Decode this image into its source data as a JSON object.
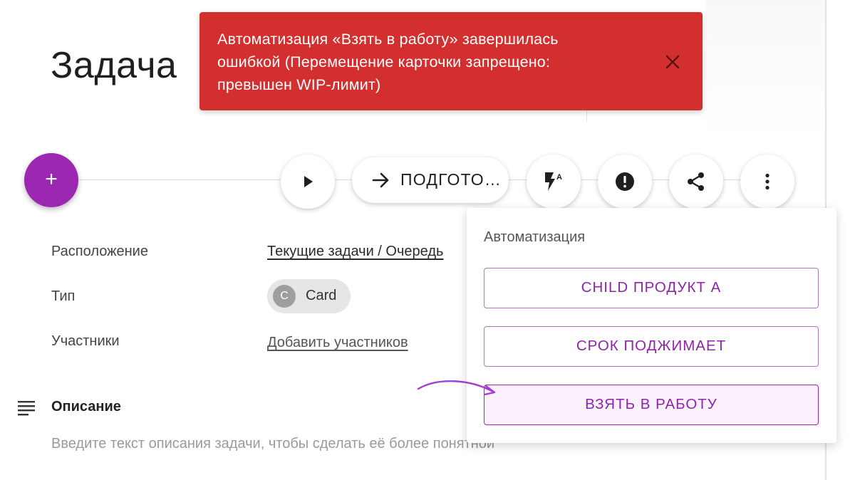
{
  "page": {
    "title": "Задача"
  },
  "toast": {
    "message_line1": "Автоматизация «Взять в работу» завершилась",
    "message_line2": "ошибкой (Перемещение карточки запрещено:",
    "message_line3": "превышен WIP-лимит)",
    "close_icon": "close-icon",
    "color": "#d32f2f"
  },
  "toolbar": {
    "add_label": "+",
    "add_color": "#9c27b0",
    "move_label": "ПОДГОТО…",
    "icons": [
      "play-icon",
      "arrow-right-icon",
      "automation-flash-icon",
      "alert-icon",
      "share-icon",
      "more-vert-icon"
    ]
  },
  "properties": {
    "location_label": "Расположение",
    "location_value": "Текущие задачи / Очередь",
    "type_label": "Тип",
    "type_avatar": "C",
    "type_value": "Card",
    "members_label": "Участники",
    "members_action": "Добавить участников"
  },
  "description": {
    "title": "Описание",
    "placeholder": "Введите текст описания задачи, чтобы сделать её более понятной"
  },
  "automation_menu": {
    "title": "Автоматизация",
    "accent_color": "#8e24aa",
    "items": [
      {
        "label": "CHILD ПРОДУКТ А"
      },
      {
        "label": "СРОК ПОДЖИМАЕТ"
      },
      {
        "label": "ВЗЯТЬ В РАБОТУ"
      }
    ]
  }
}
